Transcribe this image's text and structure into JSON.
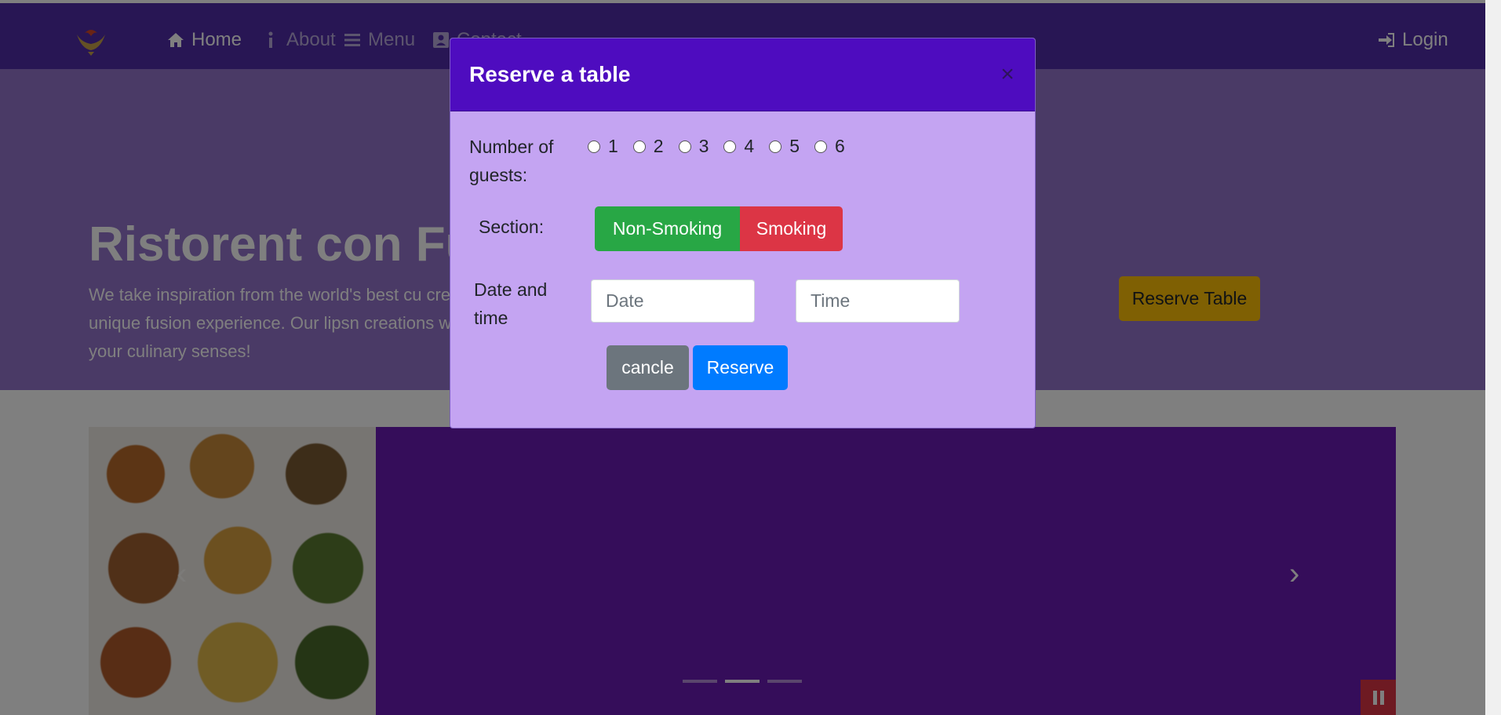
{
  "navbar": {
    "items": [
      {
        "label": "Home",
        "icon": "home-icon"
      },
      {
        "label": "About",
        "icon": "info-icon"
      },
      {
        "label": "Menu",
        "icon": "list-icon"
      },
      {
        "label": "Contact",
        "icon": "address-card-icon"
      }
    ],
    "login_label": "Login",
    "background": "#512da8"
  },
  "jumbotron": {
    "title": "Ristorent con Fus",
    "text": "We take inspiration from the world's best cu create a unique fusion experience. Our lipsn creations will tickle your culinary senses!",
    "reserve_button": "Reserve Table",
    "background": "#9575cd"
  },
  "modal": {
    "title": "Reserve a table",
    "close_icon": "×",
    "guests_label": "Number of guests:",
    "guest_options": [
      "1",
      "2",
      "3",
      "4",
      "5",
      "6"
    ],
    "section_label": "Section:",
    "section_options": [
      "Non-Smoking",
      "Smoking"
    ],
    "datetime_label": "Date and time",
    "date_placeholder": "Date",
    "time_placeholder": "Time",
    "cancel_label": "cancle",
    "reserve_label": "Reserve",
    "header_color": "#4e0cbf",
    "body_color": "#c4a4f2"
  },
  "carousel": {
    "prev_icon": "‹",
    "next_icon": "›",
    "indicator_count": 3,
    "active_indicator": 2
  }
}
